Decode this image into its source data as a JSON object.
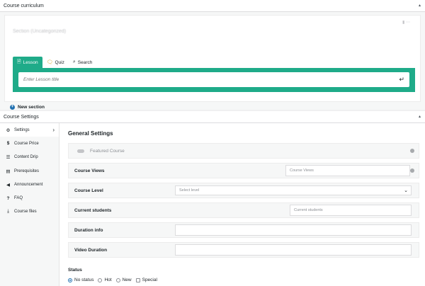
{
  "curriculum": {
    "header": "Course curriculum",
    "section_title": "Section (Uncategorized)",
    "tabs": [
      {
        "label": "Lesson",
        "icon": "document-icon"
      },
      {
        "label": "Quiz",
        "icon": "chat-icon"
      },
      {
        "label": "Search",
        "icon": "search-icon"
      }
    ],
    "lesson_placeholder": "Enter Lesson title",
    "new_section_label": "New section"
  },
  "settings": {
    "header": "Course Settings",
    "sidebar": [
      {
        "label": "Settings",
        "icon": "gear-icon"
      },
      {
        "label": "Course Price",
        "icon": "dollar-icon"
      },
      {
        "label": "Content Drip",
        "icon": "list-icon"
      },
      {
        "label": "Prerequisites",
        "icon": "prerequisites-icon"
      },
      {
        "label": "Announcement",
        "icon": "megaphone-icon"
      },
      {
        "label": "FAQ",
        "icon": "question-icon"
      },
      {
        "label": "Course files",
        "icon": "download-icon"
      }
    ],
    "general_title": "General Settings",
    "featured_label": "Featured Course",
    "fields": {
      "views_label": "Course Views",
      "views_placeholder": "Course Views",
      "level_label": "Course Level",
      "level_placeholder": "Select level",
      "students_label": "Current students",
      "students_placeholder": "Current students",
      "duration_label": "Duration info",
      "video_label": "Video Duration"
    },
    "status": {
      "label": "Status",
      "options": [
        "No status",
        "Hot",
        "New",
        "Special"
      ],
      "selected": "No status"
    }
  },
  "colors": {
    "accent": "#1fab89",
    "link_blue": "#2271b1"
  }
}
